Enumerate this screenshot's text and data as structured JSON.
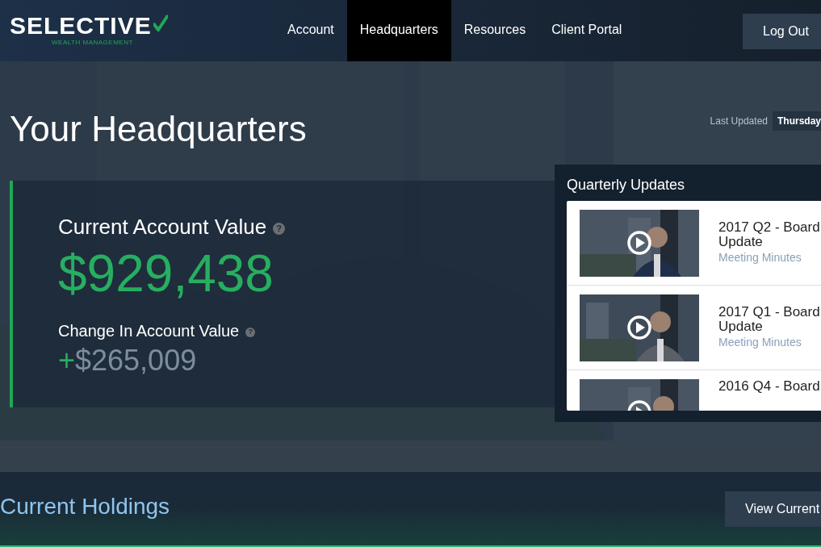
{
  "header": {
    "logo": {
      "name": "SELECTIVE",
      "tagline": "WEALTH MANAGEMENT"
    },
    "nav": [
      {
        "label": "Account",
        "selected": false
      },
      {
        "label": "Headquarters",
        "selected": true
      },
      {
        "label": "Resources",
        "selected": false
      },
      {
        "label": "Client Portal",
        "selected": false
      }
    ],
    "logout_button": "Log Out"
  },
  "hero": {
    "title": "Your Headquarters",
    "last_updated_label": "Last Updated",
    "last_updated_value": "Thursday",
    "account": {
      "current_label": "Current Account Value",
      "current_help": "?",
      "current_value": "$929,438",
      "change_label": "Change In Account Value",
      "change_help": "?",
      "change_sign": "+",
      "change_value": "$265,009"
    },
    "quarterly_updates": {
      "title": "Quarterly Updates",
      "items": [
        {
          "title": "2017 Q2 - Board Update",
          "subtitle": "Meeting Minutes"
        },
        {
          "title": "2017 Q1 - Board Update",
          "subtitle": "Meeting Minutes"
        },
        {
          "title": "2016 Q4 - Board"
        }
      ]
    }
  },
  "holdings": {
    "title": "Current Holdings",
    "button": "View Current"
  }
}
